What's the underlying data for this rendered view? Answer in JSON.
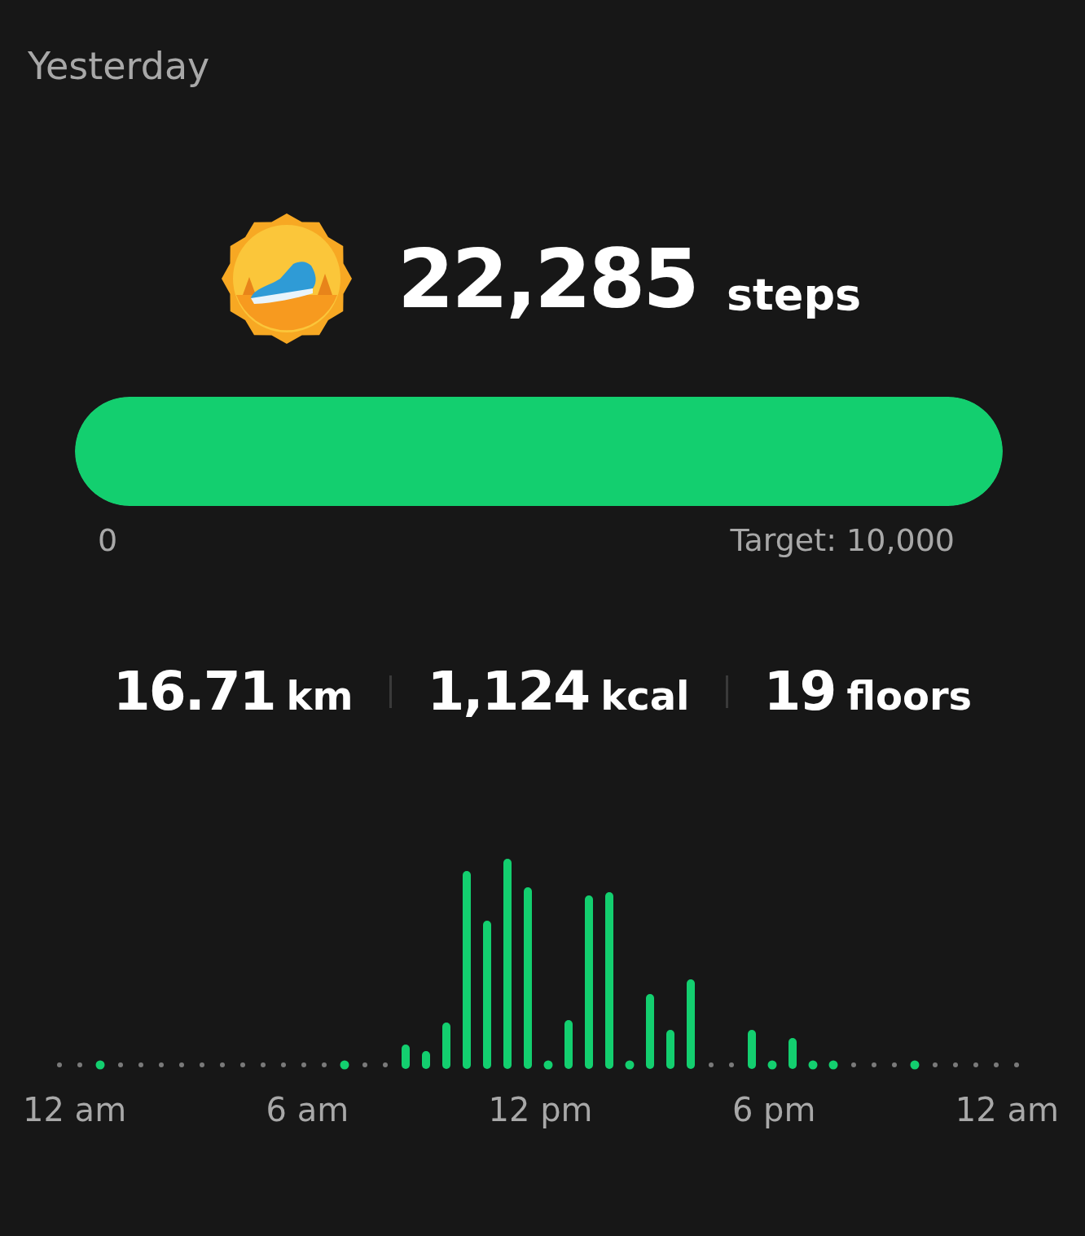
{
  "header": {
    "title": "Yesterday"
  },
  "steps": {
    "count": "22,285",
    "unit": "steps"
  },
  "progress": {
    "level": 1,
    "start_label": "0",
    "target_label": "Target: 10,000"
  },
  "stats": [
    {
      "value": "16.71",
      "unit": "km"
    },
    {
      "value": "1,124",
      "unit": "kcal"
    },
    {
      "value": "19",
      "unit": "floors"
    }
  ],
  "chart": {
    "x_labels": [
      "12 am",
      "6 am",
      "12 pm",
      "6 pm",
      "12 am"
    ]
  }
}
